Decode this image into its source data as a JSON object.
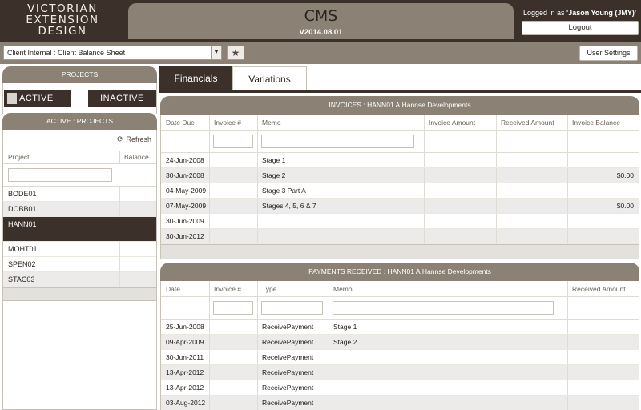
{
  "header": {
    "brand_lines": [
      "VICTORIAN",
      "EXTENSION",
      "DESIGN"
    ],
    "app_name": "CMS",
    "version": "V2014.08.01",
    "login_prefix": "Logged in as ",
    "user": "'Jason Young (JMY)'",
    "logout_label": "Logout"
  },
  "toolbar": {
    "report_selected": "Client Internal : Client Balance Sheet",
    "user_settings_label": "User Settings",
    "star_icon": "star-icon"
  },
  "sidebar": {
    "projects_title": "PROJECTS",
    "active_label": "ACTIVE",
    "inactive_label": "INACTIVE",
    "active_projects_title": "ACTIVE : PROJECTS",
    "refresh_label": "Refresh",
    "columns": [
      "Project",
      "Balance"
    ],
    "projects": [
      "BODE01",
      "DOBB01",
      "HANN01",
      "MOHT01",
      "SPEN02",
      "STAC03"
    ],
    "selected": "HANN01"
  },
  "tabs": {
    "financials": "Financials",
    "variations": "Variations"
  },
  "invoices": {
    "title": "INVOICES : HANN01 A,Hannse Developments",
    "columns": [
      "Date Due",
      "Invoice #",
      "Memo",
      "Invoice Amount",
      "Received Amount",
      "Invoice Balance"
    ],
    "rows": [
      {
        "date": "24-Jun-2008",
        "invoice": "",
        "memo": "Stage 1",
        "amount": "",
        "received": "",
        "balance": ""
      },
      {
        "date": "30-Jun-2008",
        "invoice": "",
        "memo": "Stage 2",
        "amount": "",
        "received": "",
        "balance": "$0.00"
      },
      {
        "date": "04-May-2009",
        "invoice": "",
        "memo": "Stage 3 Part A",
        "amount": "",
        "received": "",
        "balance": ""
      },
      {
        "date": "07-May-2009",
        "invoice": "",
        "memo": "Stages 4, 5, 6 & 7",
        "amount": "",
        "received": "",
        "balance": "$0.00"
      },
      {
        "date": "30-Jun-2009",
        "invoice": "",
        "memo": "",
        "amount": "",
        "received": "",
        "balance": ""
      },
      {
        "date": "30-Jun-2012",
        "invoice": "",
        "memo": "",
        "amount": "",
        "received": "",
        "balance": ""
      }
    ]
  },
  "payments": {
    "title": "PAYMENTS RECEIVED : HANN01 A,Hannse Developments",
    "columns": [
      "Date",
      "Invoice #",
      "Type",
      "Memo",
      "Received Amount"
    ],
    "rows": [
      {
        "date": "25-Jun-2008",
        "invoice": "",
        "type": "ReceivePayment",
        "memo": "Stage 1",
        "amount": ""
      },
      {
        "date": "09-Apr-2009",
        "invoice": "",
        "type": "ReceivePayment",
        "memo": "Stage 2",
        "amount": ""
      },
      {
        "date": "30-Jun-2011",
        "invoice": "",
        "type": "ReceivePayment",
        "memo": "",
        "amount": ""
      },
      {
        "date": "13-Apr-2012",
        "invoice": "",
        "type": "ReceivePayment",
        "memo": "",
        "amount": ""
      },
      {
        "date": "13-Apr-2012",
        "invoice": "",
        "type": "ReceivePayment",
        "memo": "",
        "amount": ""
      },
      {
        "date": "03-Aug-2012",
        "invoice": "",
        "type": "ReceivePayment",
        "memo": "",
        "amount": ""
      }
    ]
  }
}
